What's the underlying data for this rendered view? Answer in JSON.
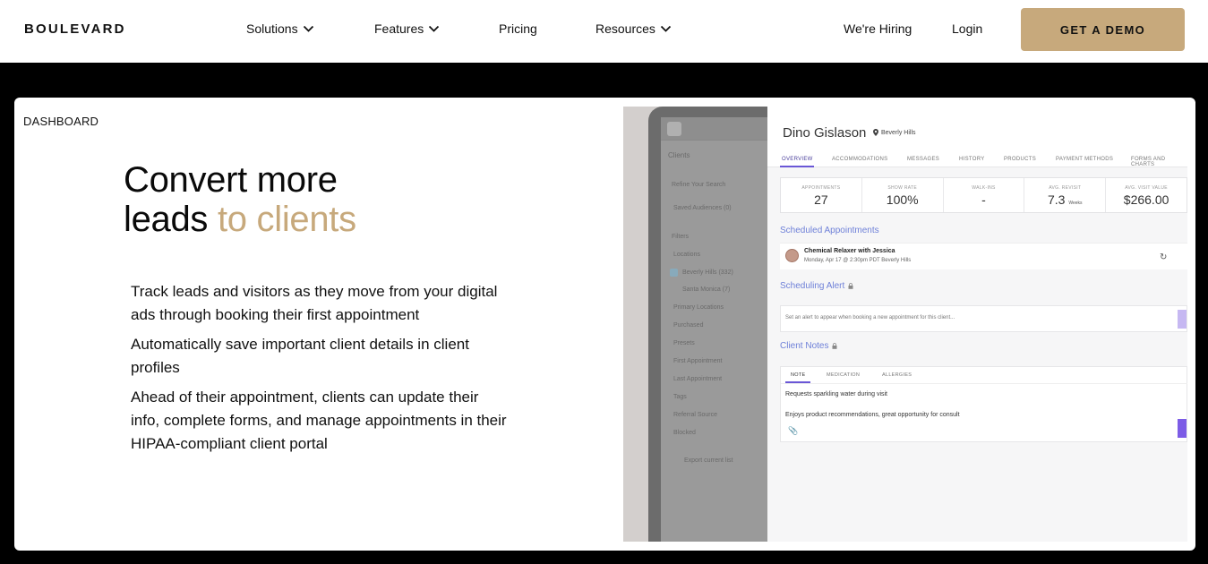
{
  "nav": {
    "logo": "BOULEVARD",
    "items": [
      {
        "label": "Solutions",
        "dropdown": true
      },
      {
        "label": "Features",
        "dropdown": true
      },
      {
        "label": "Pricing",
        "dropdown": false
      },
      {
        "label": "Resources",
        "dropdown": true
      }
    ],
    "hiring": "We're Hiring",
    "login": "Login",
    "cta": "GET A DEMO",
    "cta_color": "#c7a97c"
  },
  "hero": {
    "eyebrow": "DASHBOARD",
    "headline_line1": "Convert more",
    "headline_line2a": "leads",
    "headline_line2b": " to clients",
    "accent_color": "#c7a97c",
    "bullets": [
      "Track leads and visitors as they move from your digital ads through booking their first appointment",
      "Automatically save important client details in client profiles",
      "Ahead of their appointment, clients can update their info, complete forms, and manage appointments in their HIPAA-compliant client portal"
    ]
  },
  "dashboard": {
    "sidebar": {
      "title": "Clients",
      "refine": "Refine Your Search",
      "items": [
        "Saved Audiences (0)",
        "Filters",
        "Locations",
        "Beverly Hills (332)",
        "Santa Monica (7)",
        "Primary Locations",
        "Purchased",
        "Presets",
        "First Appointment",
        "Last Appointment",
        "Tags",
        "Referral Source",
        "Blocked",
        "Export current list"
      ]
    },
    "client_name": "Dino Gislason",
    "location": "Beverly Hills",
    "tabs": [
      "OVERVIEW",
      "ACCOMMODATIONS",
      "MESSAGES",
      "HISTORY",
      "PRODUCTS",
      "PAYMENT METHODS",
      "FORMS AND CHARTS"
    ],
    "stats": [
      {
        "label": "APPOINTMENTS",
        "value": "27",
        "unit": ""
      },
      {
        "label": "SHOW RATE",
        "value": "100%",
        "unit": ""
      },
      {
        "label": "WALK-INS",
        "value": "-",
        "unit": ""
      },
      {
        "label": "AVG. REVISIT",
        "value": "7.3",
        "unit": "Weeks"
      },
      {
        "label": "AVG. VISIT VALUE",
        "value": "$266.00",
        "unit": ""
      }
    ],
    "scheduled_title": "Scheduled Appointments",
    "appointment": {
      "title": "Chemical Relaxer with Jessica",
      "subtitle": "Monday, Apr 17 @ 2:30pm PDT Beverly Hills"
    },
    "alert_title": "Scheduling Alert",
    "alert_placeholder": "Set an alert to appear when booking a new appointment for this client...",
    "notes_title": "Client Notes",
    "note_tabs": [
      "NOTE",
      "MEDICATION",
      "ALLERGIES"
    ],
    "note_lines": [
      "Requests sparkling water during visit",
      "Enjoys product recommendations, great opportunity for consult"
    ]
  }
}
